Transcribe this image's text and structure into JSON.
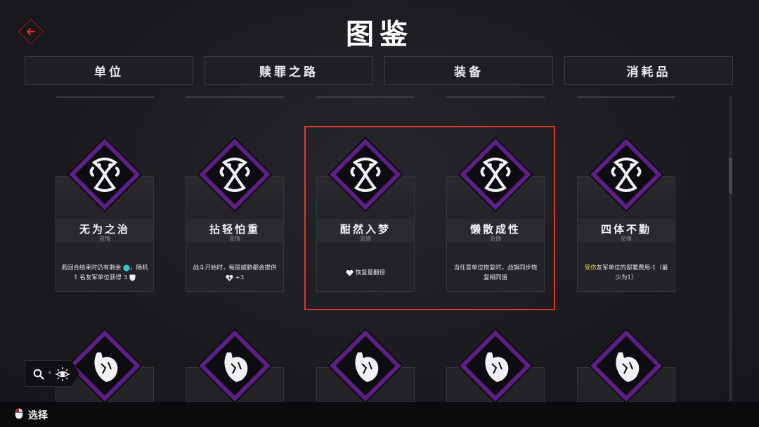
{
  "title": "图鉴",
  "tabs": [
    "单位",
    "赎罪之路",
    "装备",
    "消耗品"
  ],
  "cards": [
    {
      "name": "无为之治",
      "sub": "怠惰",
      "desc_pre": "若回合结束时仍有剩余",
      "desc_mid": "，随机1 名友军单位获得 3",
      "desc_post": ""
    },
    {
      "name": "拈轻怕重",
      "sub": "怠惰",
      "desc_pre": "战斗开始时，每层威胁都会提供",
      "desc_mid": "+3",
      "desc_post": ""
    },
    {
      "name": "酣然入梦",
      "sub": "怠惰",
      "desc_pre": "",
      "desc_mid": "恢复量翻倍",
      "desc_post": ""
    },
    {
      "name": "懒散成性",
      "sub": "怠惰",
      "desc_pre": "当任意单位恢复时，战旗同步恢复相同值",
      "desc_mid": "",
      "desc_post": ""
    },
    {
      "name": "四体不勤",
      "sub": "怠惰",
      "desc_highlight": "受伤",
      "desc_rest": "友军单位的部署费用-1（最少为1）"
    }
  ],
  "search": {
    "key_hint": "R"
  },
  "footer": {
    "select_label": "选择"
  },
  "colors": {
    "accent_purple": "#5c1f86",
    "selection_red": "#d83a2a",
    "highlight_yellow": "#e6d35a"
  }
}
